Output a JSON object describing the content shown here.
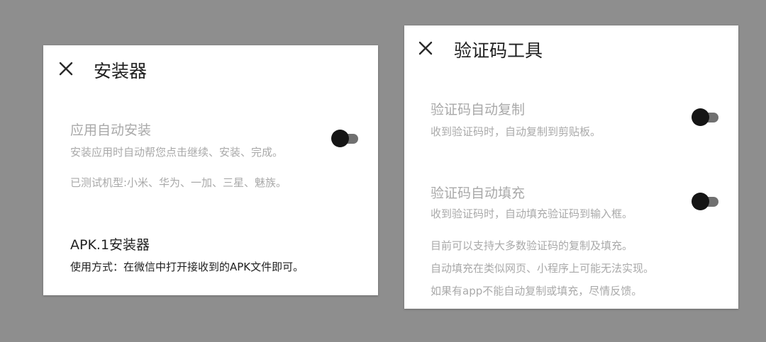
{
  "installer": {
    "close_icon": "close-icon",
    "title": "安装器",
    "auto_install": {
      "title": "应用自动安装",
      "description": "安装应用时自动帮您点击继续、安装、完成。",
      "toggle_on": false
    },
    "tested_models": "已测试机型:小米、华为、一加、三星、魅族。",
    "apk1": {
      "title": "APK.1安装器",
      "description": "使用方式：在微信中打开接收到的APK文件即可。"
    }
  },
  "captcha": {
    "close_icon": "close-icon",
    "title": "验证码工具",
    "auto_copy": {
      "title": "验证码自动复制",
      "description": "收到验证码时，自动复制到剪贴板。",
      "toggle_on": false
    },
    "auto_fill": {
      "title": "验证码自动填充",
      "description": "收到验证码时，自动填充验证码到输入框。",
      "toggle_on": false
    },
    "notes": [
      "目前可以支持大多数验证码的复制及填充。",
      "自动填充在类似网页、小程序上可能无法实现。",
      "如果有app不能自动复制或填充，尽情反馈。"
    ]
  },
  "colors": {
    "background": "#8e8e8e",
    "panel": "#ffffff",
    "muted_text": "#a9a9a9",
    "dark_text": "#1f1f1f",
    "toggle_knob": "#151515",
    "toggle_track": "#707070"
  }
}
